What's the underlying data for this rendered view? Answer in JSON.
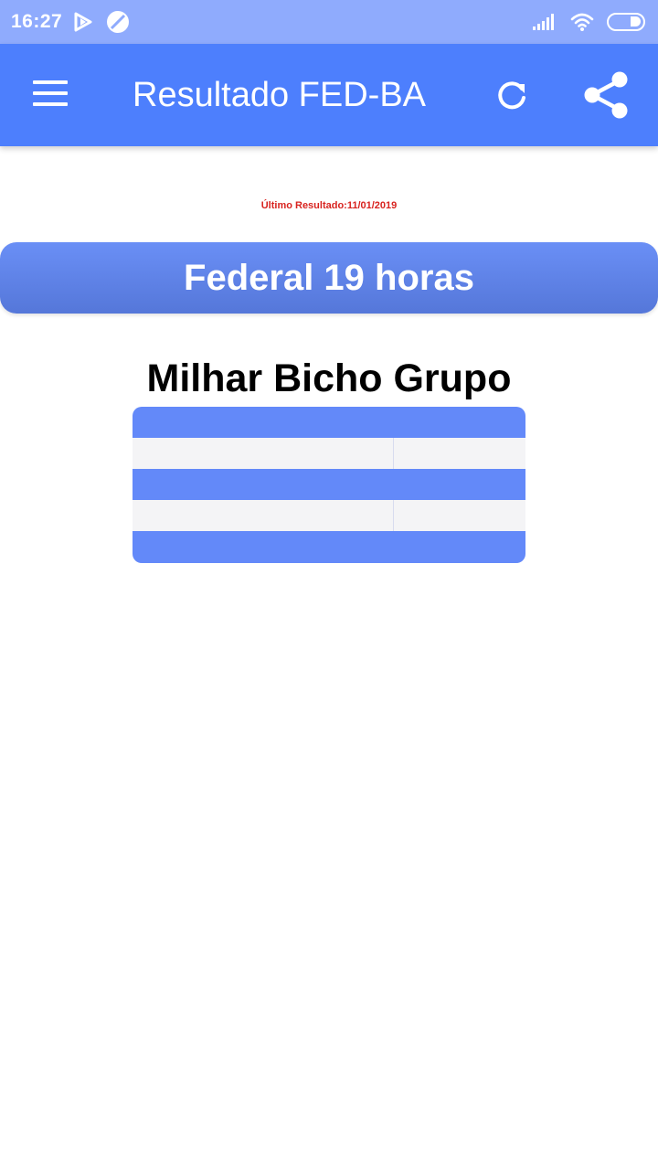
{
  "status_bar": {
    "time": "16:27",
    "left_icons": [
      "play-store-notification-icon",
      "blocked-circle-icon"
    ],
    "right_icons": [
      "signal-icon",
      "wifi-icon",
      "battery-icon"
    ]
  },
  "app_bar": {
    "title": "Resultado FED-BA",
    "menu_icon": "hamburger-menu-icon",
    "refresh_icon": "refresh-icon",
    "share_icon": "share-icon"
  },
  "content": {
    "last_result_label": "Último Resultado:11/01/2019",
    "section_header": "Federal 19 horas",
    "table_title": "Milhar Bicho Grupo",
    "rows": [
      {
        "milhar": "",
        "bicho": ""
      },
      {
        "milhar": "",
        "bicho": ""
      },
      {
        "milhar": "",
        "bicho": ""
      },
      {
        "milhar": "",
        "bicho": ""
      },
      {
        "milhar": "",
        "bicho": ""
      }
    ]
  },
  "colors": {
    "status_bar": "#8fabfd",
    "app_bar": "#4d7ffd",
    "accent_red": "#d8231f",
    "row_blue": "#6389f9",
    "row_gray": "#f4f4f6"
  }
}
